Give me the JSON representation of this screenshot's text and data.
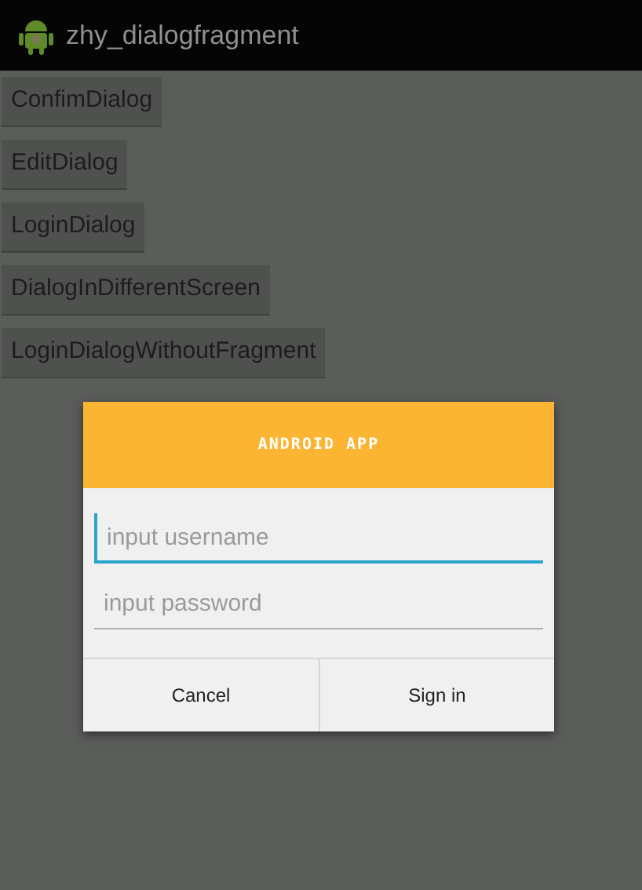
{
  "action_bar": {
    "title": "zhy_dialogfragment"
  },
  "buttons": [
    "ConfimDialog",
    "EditDialog",
    "LoginDialog",
    "DialogInDifferentScreen",
    "LoginDialogWithoutFragment"
  ],
  "dialog": {
    "title": "ANDROID APP",
    "fields": [
      {
        "placeholder": "input username",
        "focused": true
      },
      {
        "placeholder": "input password",
        "focused": false
      }
    ],
    "actions": [
      "Cancel",
      "Sign in"
    ]
  }
}
